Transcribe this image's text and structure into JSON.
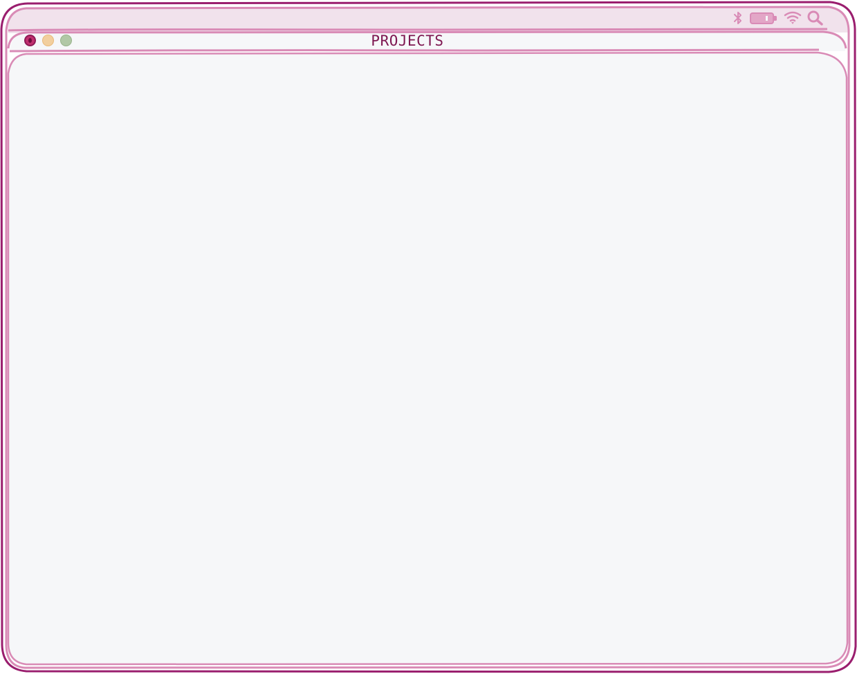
{
  "window": {
    "title": "PROJECTS"
  },
  "menubar": {
    "icons": [
      "bluetooth-icon",
      "battery-icon",
      "wifi-icon",
      "search-icon"
    ]
  },
  "traffic_lights": [
    "close",
    "minimize",
    "maximize"
  ],
  "colors": {
    "frame_dark": "#9a1e6e",
    "frame_light": "#d98bb6",
    "menubar_bg": "#f1e2ec",
    "window_bg": "#f6f7f9",
    "title_text": "#7d1650",
    "close": "#c0306f",
    "minimize": "#f2cf9e",
    "maximize": "#b1c8a6"
  }
}
